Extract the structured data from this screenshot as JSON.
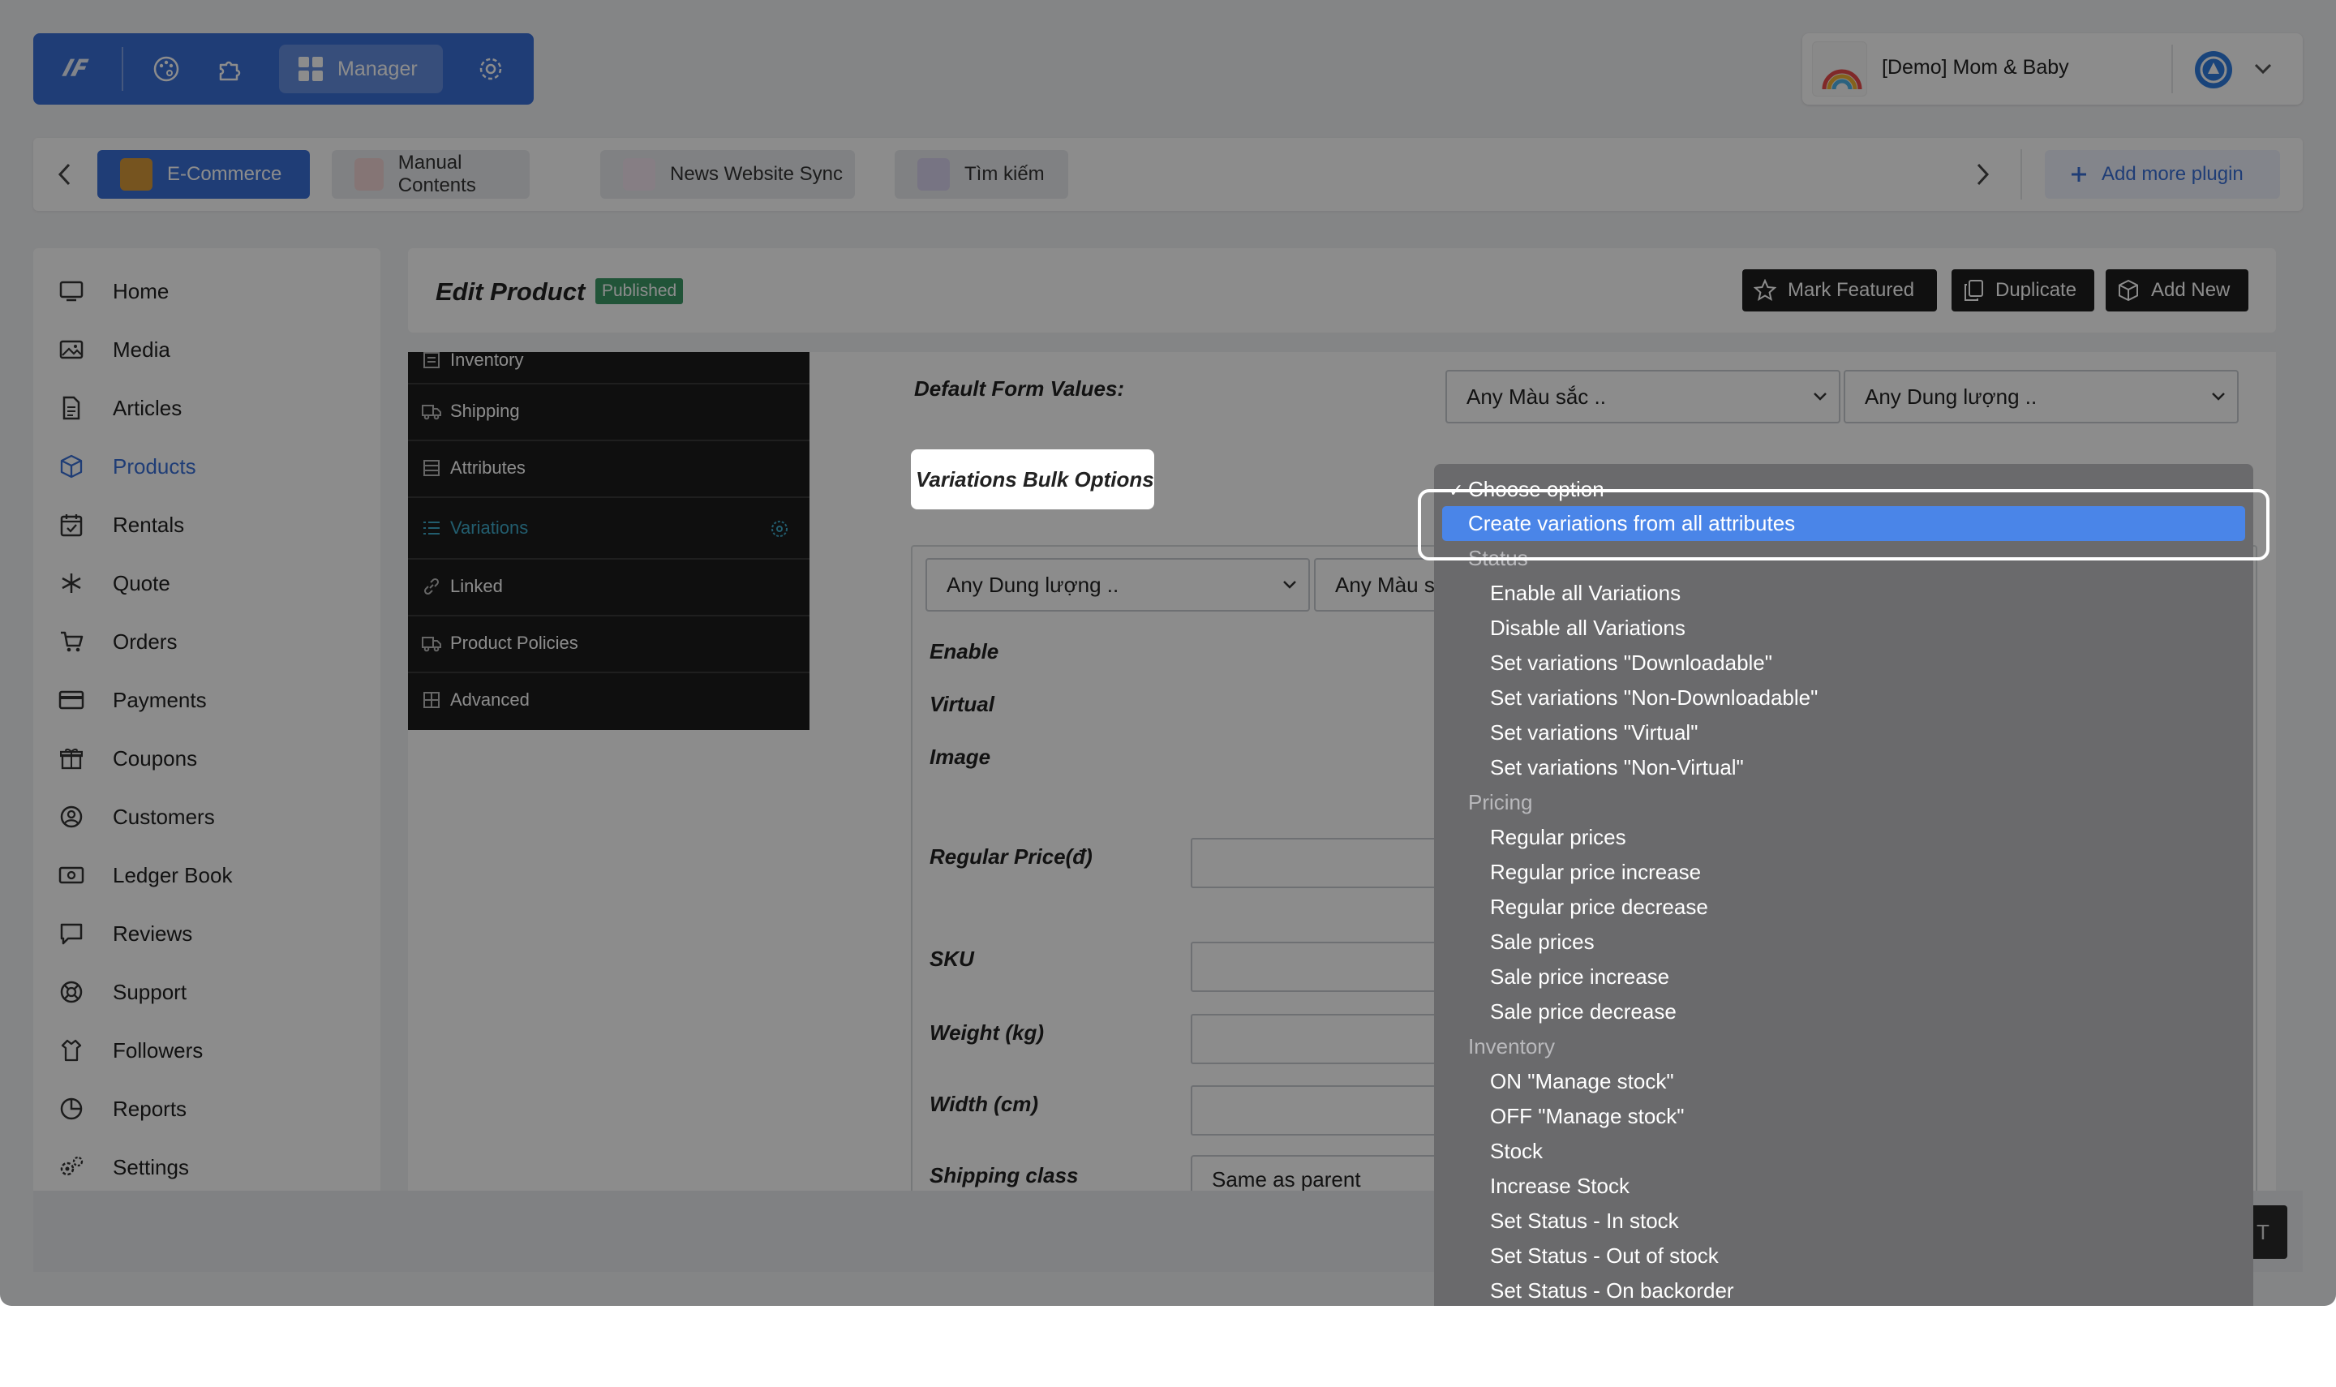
{
  "toolbar": {
    "manager_label": "Manager"
  },
  "store": {
    "name": "[Demo] Mom & Baby"
  },
  "plugin_tabs": [
    {
      "label": "E-Commerce"
    },
    {
      "label": "Manual Contents"
    },
    {
      "label": "News Website Sync"
    },
    {
      "label": "Tìm kiếm"
    }
  ],
  "add_plugin_label": "Add more plugin",
  "sidebar": {
    "items": [
      {
        "label": "Home",
        "icon": "monitor-icon"
      },
      {
        "label": "Media",
        "icon": "image-icon"
      },
      {
        "label": "Articles",
        "icon": "file-icon"
      },
      {
        "label": "Products",
        "icon": "box-icon"
      },
      {
        "label": "Rentals",
        "icon": "calendar-icon"
      },
      {
        "label": "Quote",
        "icon": "snowflake-icon"
      },
      {
        "label": "Orders",
        "icon": "cart-icon"
      },
      {
        "label": "Payments",
        "icon": "card-icon"
      },
      {
        "label": "Coupons",
        "icon": "gift-icon"
      },
      {
        "label": "Customers",
        "icon": "user-circle-icon"
      },
      {
        "label": "Ledger Book",
        "icon": "cash-icon"
      },
      {
        "label": "Reviews",
        "icon": "comment-icon"
      },
      {
        "label": "Support",
        "icon": "lifebuoy-icon"
      },
      {
        "label": "Followers",
        "icon": "shirt-icon"
      },
      {
        "label": "Reports",
        "icon": "pie-chart-icon"
      },
      {
        "label": "Settings",
        "icon": "cogs-icon"
      }
    ],
    "active": "Products"
  },
  "header": {
    "title": "Edit Product",
    "status_badge": "Published",
    "mark_featured": "Mark Featured",
    "duplicate": "Duplicate",
    "add_new": "Add New"
  },
  "product_tabs": [
    {
      "label": "Inventory"
    },
    {
      "label": "Shipping"
    },
    {
      "label": "Attributes"
    },
    {
      "label": "Variations"
    },
    {
      "label": "Linked"
    },
    {
      "label": "Product Policies"
    },
    {
      "label": "Advanced"
    }
  ],
  "form": {
    "default_form_values_label": "Default Form Values:",
    "default_color": "Any Màu sắc ..",
    "default_capacity": "Any Dung lượng ..",
    "bulk_options_label": "Variations Bulk Options",
    "variation_capacity": "Any Dung lượng ..",
    "variation_color": "Any Màu s",
    "enable_label": "Enable",
    "virtual_label": "Virtual",
    "image_label": "Image",
    "regular_price_label": "Regular Price(đ)",
    "sku_label": "SKU",
    "weight_label": "Weight (kg)",
    "width_label": "Width (cm)",
    "shipping_class_label": "Shipping class",
    "shipping_class_value": "Same as parent"
  },
  "bulk_dropdown": {
    "selected": "Choose option",
    "highlighted": "Create variations from all attributes",
    "groups": [
      {
        "label": "Status",
        "options": [
          "Enable all Variations",
          "Disable all Variations",
          "Set variations \"Downloadable\"",
          "Set variations \"Non-Downloadable\"",
          "Set variations \"Virtual\"",
          "Set variations \"Non-Virtual\""
        ]
      },
      {
        "label": "Pricing",
        "options": [
          "Regular prices",
          "Regular price increase",
          "Regular price decrease",
          "Sale prices",
          "Sale price increase",
          "Sale price decrease"
        ]
      },
      {
        "label": "Inventory",
        "options": [
          "ON \"Manage stock\"",
          "OFF \"Manage stock\"",
          "Stock",
          "Increase Stock",
          "Set Status - In stock",
          "Set Status - Out of stock",
          "Set Status - On backorder"
        ]
      }
    ]
  },
  "partial_button_text": "T",
  "colors": {
    "accent": "#3a6fd8",
    "highlight": "#4a85e8",
    "published": "#3d9a66",
    "dark_tab": "#1c1c1c",
    "active_tab": "#3fa9c9"
  }
}
